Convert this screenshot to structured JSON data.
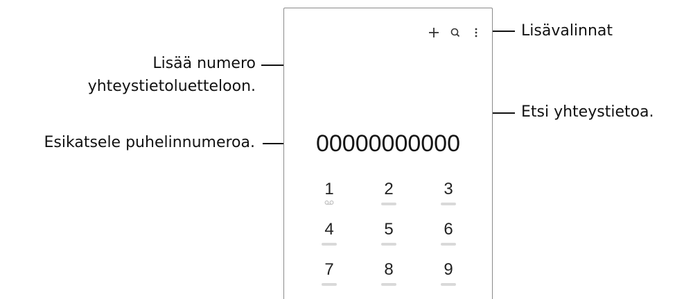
{
  "callouts": {
    "add_number": [
      "Lisää numero",
      "yhteystietoluetteloon."
    ],
    "more_options": "Lisävalinnat",
    "search_contact": "Etsi yhteystietoa.",
    "preview_number": "Esikatsele puhelinnumeroa."
  },
  "dialer": {
    "toolbar": {
      "add_icon": "plus-icon",
      "search_icon": "search-icon",
      "more_icon": "more-vertical-icon"
    },
    "number": "00000000000",
    "keys": [
      {
        "digit": "1",
        "sub": "voicemail-icon"
      },
      {
        "digit": "2"
      },
      {
        "digit": "3"
      },
      {
        "digit": "4"
      },
      {
        "digit": "5"
      },
      {
        "digit": "6"
      },
      {
        "digit": "7"
      },
      {
        "digit": "8"
      },
      {
        "digit": "9"
      }
    ]
  },
  "colors": {
    "text": "#111111",
    "frame": "#8a8a8a",
    "key_subtext": "#d9d9d9"
  }
}
